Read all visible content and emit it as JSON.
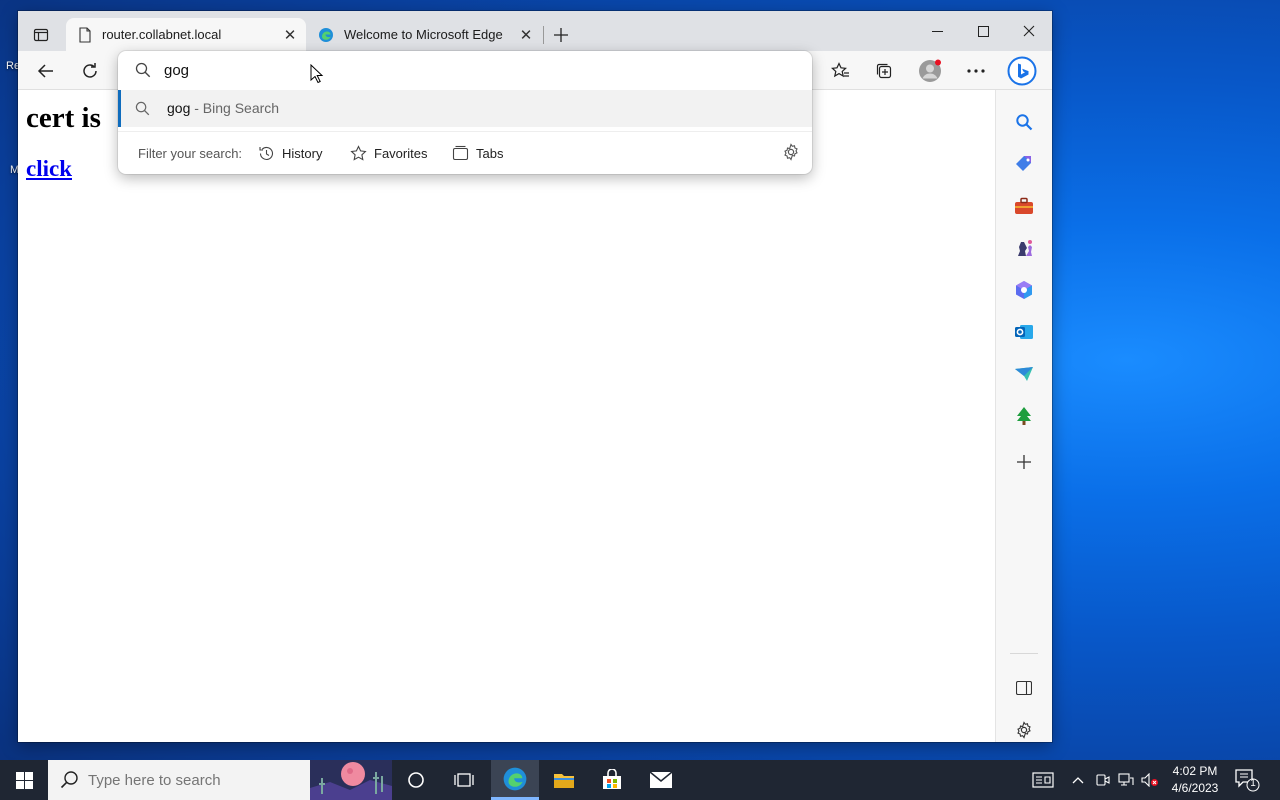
{
  "desktop": {
    "frag1": "Re",
    "frag2": "M"
  },
  "browser": {
    "tabs": [
      {
        "title": "router.collabnet.local",
        "active": true
      },
      {
        "title": "Welcome to Microsoft Edge",
        "active": false
      }
    ],
    "address": {
      "value": "gog",
      "suggestion_query": "gog",
      "suggestion_source": " - Bing Search",
      "filter_label": "Filter your search:",
      "filters": [
        "History",
        "Favorites",
        "Tabs"
      ]
    },
    "page": {
      "heading": "cert is",
      "link": "click"
    }
  },
  "taskbar": {
    "search_placeholder": "Type here to search",
    "time": "4:02 PM",
    "date": "4/6/2023",
    "notification_count": "1"
  },
  "colors": {
    "accent": "#0f6cbd",
    "taskbar": "#1f2633",
    "link": "#0000ee"
  }
}
